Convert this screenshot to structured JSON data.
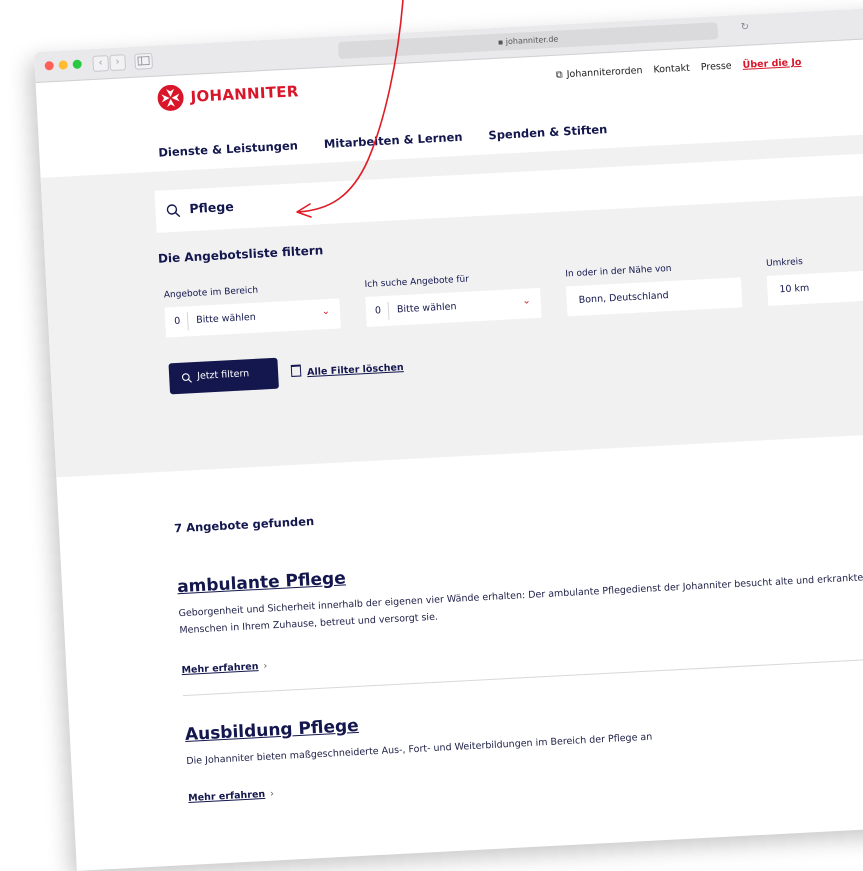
{
  "browser": {
    "url": "johanniter.de",
    "back": "‹",
    "forward": "›"
  },
  "site": {
    "logo_text": "JOHANNITER",
    "util_nav": {
      "orden": "Johanniterorden",
      "kontakt": "Kontakt",
      "presse": "Presse",
      "ueber": "Über die Jo"
    },
    "main_nav": [
      "Dienste & Leistungen",
      "Mitarbeiten & Lernen",
      "Spenden & Stiften"
    ],
    "brand_color": "#d9152a",
    "primary_color": "#13174d"
  },
  "search": {
    "query": "Pflege"
  },
  "filters": {
    "title": "Die Angebotsliste filtern",
    "bereich": {
      "label": "Angebote im Bereich",
      "count": "0",
      "value": "Bitte wählen"
    },
    "fuer": {
      "label": "Ich suche Angebote für",
      "count": "0",
      "value": "Bitte wählen"
    },
    "naehe": {
      "label": "In oder in der Nähe von",
      "value": "Bonn, Deutschland"
    },
    "umkreis": {
      "label": "Umkreis",
      "value": "10 km"
    },
    "submit_label": "Jetzt filtern",
    "clear_label": "Alle Filter löschen"
  },
  "results": {
    "count_label": "7 Angebote gefunden",
    "items": [
      {
        "title": "ambulante Pflege",
        "description": "Geborgenheit und Sicherheit innerhalb der eigenen vier Wände erhalten: Der ambulante Pflegedienst der Johanniter besucht alte und erkrankte Menschen in Ihrem Zuhause, betreut und versorgt sie.",
        "more_label": "Mehr erfahren"
      },
      {
        "title": "Ausbildung Pflege",
        "description": "Die Johanniter bieten maßgeschneiderte Aus-, Fort- und Weiterbildungen im Bereich der Pflege an",
        "more_label": "Mehr erfahren"
      }
    ]
  }
}
